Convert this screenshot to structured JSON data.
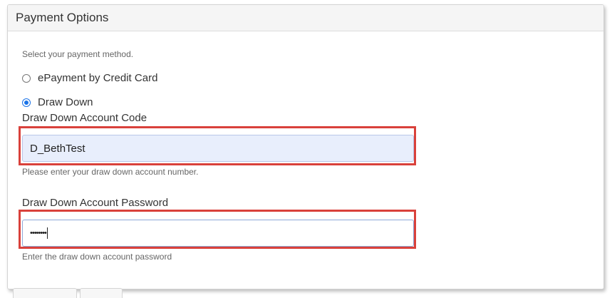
{
  "panel": {
    "title": "Payment Options",
    "instruction": "Select your payment method.",
    "payment_methods": [
      {
        "label": "ePayment by Credit Card",
        "selected": false
      },
      {
        "label": "Draw Down",
        "selected": true
      }
    ],
    "account_code": {
      "label": "Draw Down Account Code",
      "value": "D_BethTest",
      "help": "Please enter your draw down account number."
    },
    "account_password": {
      "label": "Draw Down Account Password",
      "masked_value": "••••••••",
      "help": "Enter the draw down account password"
    }
  },
  "colors": {
    "highlight": "#d9413b",
    "radio_selected": "#1a73e8",
    "autofill_background": "#e8eefc"
  }
}
